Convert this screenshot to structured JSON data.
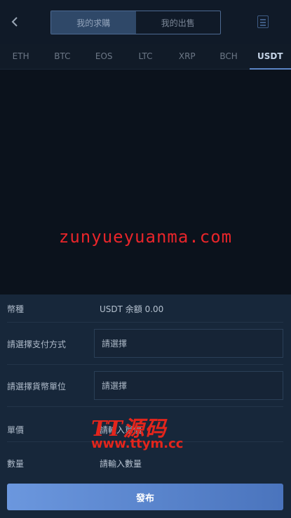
{
  "header": {
    "back_icon": "chevron-left-icon",
    "segments": [
      "我的求購",
      "我的出售"
    ],
    "active_segment": 0,
    "list_icon": "list-icon"
  },
  "coin_tabs": [
    "ETH",
    "BTC",
    "EOS",
    "LTC",
    "XRP",
    "BCH",
    "USDT"
  ],
  "active_coin": "USDT",
  "watermark": "zunyueyuanma.com",
  "form": {
    "currency": {
      "label": "幣種",
      "value": "USDT 余額 0.00"
    },
    "payment": {
      "label": "請選擇支付方式",
      "placeholder": "請選擇"
    },
    "fiat": {
      "label": "請選擇貨幣單位",
      "placeholder": "請選擇"
    },
    "price": {
      "label": "單價",
      "placeholder": "請輸入單價"
    },
    "quantity": {
      "label": "數量",
      "placeholder": "請輸入數量"
    }
  },
  "logo": {
    "top": "TT源码",
    "bottom": "www.ttym.cc"
  },
  "publish_label": "發布",
  "colors": {
    "accent": "#5b85c5",
    "watermark": "#e8252a",
    "background": "#0c1420"
  }
}
